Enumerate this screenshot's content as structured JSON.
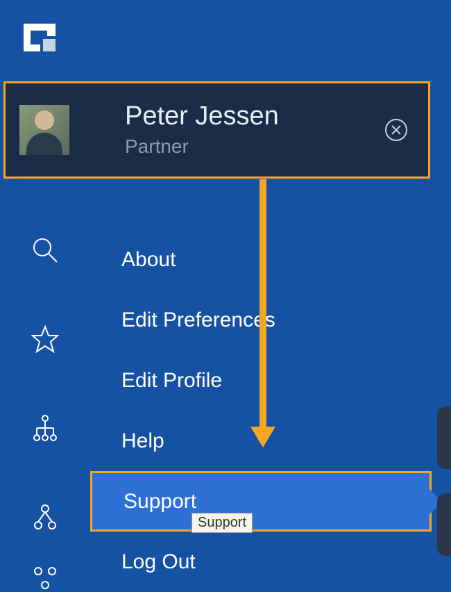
{
  "logo": {
    "name": "app-logo"
  },
  "profile": {
    "name": "Peter Jessen",
    "role": "Partner",
    "close_label": "Close"
  },
  "rail": {
    "icons": [
      {
        "name": "search-icon"
      },
      {
        "name": "star-icon"
      },
      {
        "name": "org-tree-icon"
      },
      {
        "name": "hierarchy-icon"
      },
      {
        "name": "people-icon"
      }
    ]
  },
  "menu": {
    "items": [
      {
        "label": "About",
        "selected": false
      },
      {
        "label": "Edit Preferences",
        "selected": false
      },
      {
        "label": "Edit Profile",
        "selected": false
      },
      {
        "label": "Help",
        "selected": false
      },
      {
        "label": "Support",
        "selected": true
      },
      {
        "label": "Log Out",
        "selected": false
      }
    ]
  },
  "tooltip": {
    "text": "Support"
  },
  "colors": {
    "background": "#1652a3",
    "card_bg": "#1a2c47",
    "highlight_border": "#f5a623",
    "selected_bg": "#2e6fd4"
  }
}
